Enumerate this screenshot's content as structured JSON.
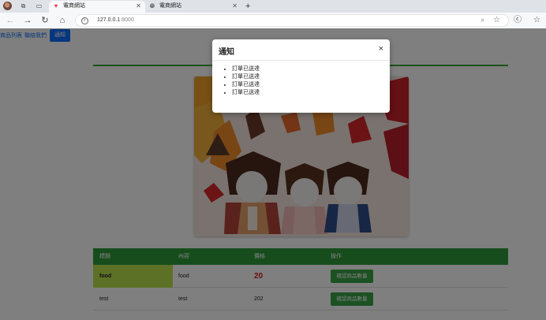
{
  "browser": {
    "tabs": [
      {
        "title": "電商網站",
        "favicon": "heart-icon"
      },
      {
        "title": "電商網站",
        "favicon": "globe-icon"
      }
    ],
    "url_host": "127.0.0.1",
    "url_port": ":8000"
  },
  "nav": {
    "links": [
      "商品列表",
      "聯絡我們"
    ],
    "notify_button": "通知"
  },
  "modal": {
    "title": "通知",
    "close": "×",
    "messages": [
      "訂單已送達",
      "訂單已送達",
      "訂單已送達",
      "訂單已送達"
    ]
  },
  "table": {
    "headers": [
      "標題",
      "內容",
      "價格",
      "操作"
    ],
    "rows": [
      {
        "title": "food",
        "content": "food",
        "price": "20",
        "action": "確認商品數量"
      },
      {
        "title": "test",
        "content": "test",
        "price": "202",
        "action": "確認商品數量"
      }
    ]
  },
  "colors": {
    "primary": "#0d6efd",
    "success": "#2f9a3a",
    "highlight": "#b9e24c",
    "danger": "#d81b1b"
  }
}
